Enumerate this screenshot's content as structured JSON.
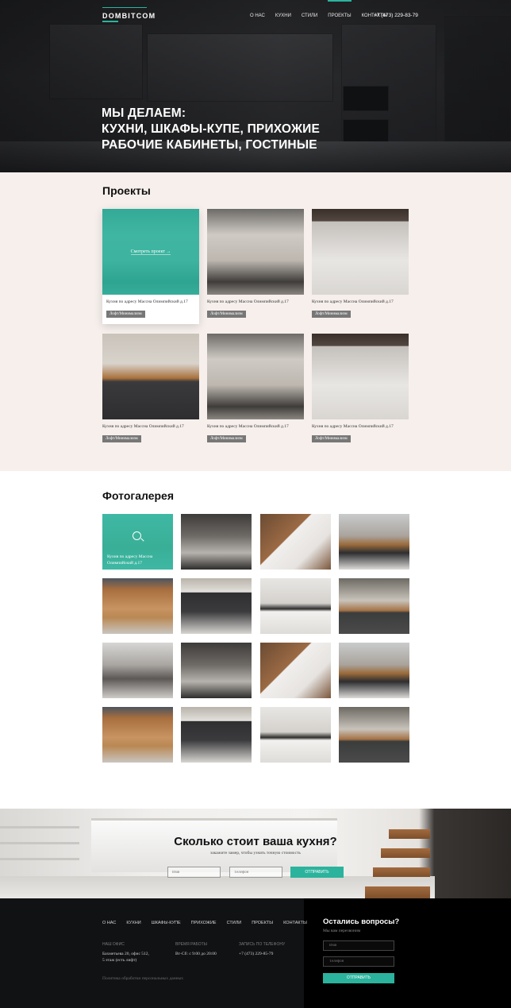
{
  "header": {
    "logo": "DOMBITCOM",
    "nav": [
      "О НАС",
      "КУХНИ",
      "СТИЛИ",
      "ПРОЕКТЫ",
      "КОНТАКТЫ"
    ],
    "active_nav": "ПРОЕКТЫ",
    "phone": "+7 (473) 229-83-79"
  },
  "hero": {
    "lines": [
      "МЫ ДЕЛАЕМ:",
      "КУХНИ, ШКАФЫ-КУПЕ, ПРИХОЖИЕ",
      "РАБОЧИЕ КАБИНЕТЫ, ГОСТИНЫЕ"
    ]
  },
  "projects": {
    "title": "Проекты",
    "overlay_label": "Смотреть проект →",
    "items": [
      {
        "caption": "Кухня по адресу Массна Олимпийский д.17",
        "tag": "Лофт/Минимализм"
      },
      {
        "caption": "Кухня по адресу Массна Олимпийский д.17",
        "tag": "Лофт/Минимализм"
      },
      {
        "caption": "Кухня по адресу Массна Олимпийский д.17",
        "tag": "Лофт/Минимализм"
      },
      {
        "caption": "Кухня по адресу Массна Олимпийский д.17",
        "tag": "Лофт/Минимализм"
      },
      {
        "caption": "Кухня по адресу Массна Олимпийский д.17",
        "tag": "Лофт/Минимализм"
      },
      {
        "caption": "Кухня по адресу Массна Олимпийский д.17",
        "tag": "Лофт/Минимализм"
      }
    ]
  },
  "gallery": {
    "title": "Фотогалерея",
    "overlay_caption": "Кухня по адресу Массна Олимпийский д.17"
  },
  "cta": {
    "title": "Сколько стоит ваша кухня?",
    "subtitle": "закажите замер, чтобы узнать точную стоимость",
    "name_placeholder": "Имя",
    "phone_placeholder": "Телефон",
    "button": "ОТПРАВИТЬ"
  },
  "footer": {
    "nav": [
      "О НАС",
      "КУХНИ",
      "ШКАФЫ-КУПЕ",
      "ПРИХОЖИЕ",
      "СТИЛИ",
      "ПРОЕКТЫ",
      "КОНТАКТЫ"
    ],
    "office_label": "НАШ ОФИС",
    "office_address_1": "Бахметьева 20, офис 512,",
    "office_address_2": "5 этаж (есть лифт)",
    "hours_label": "ВРЕМЯ РАБОТЫ",
    "hours": "Вт-Сб: с 9:00 до 20:00",
    "phone_label": "ЗАПИСЬ ПО ТЕЛЕФОНУ",
    "phone": "+7 (473) 229-85-79",
    "policy": "Политика обработки персональных данных",
    "questions_title": "Остались вопросы?",
    "questions_sub": "Мы вам перезвоним",
    "name_placeholder": "Имя",
    "phone_placeholder": "Телефон",
    "button": "ОТПРАВИТЬ"
  },
  "colors": {
    "accent": "#2bb39d",
    "projects_bg": "#f6efec",
    "footer_bg": "#111214"
  }
}
